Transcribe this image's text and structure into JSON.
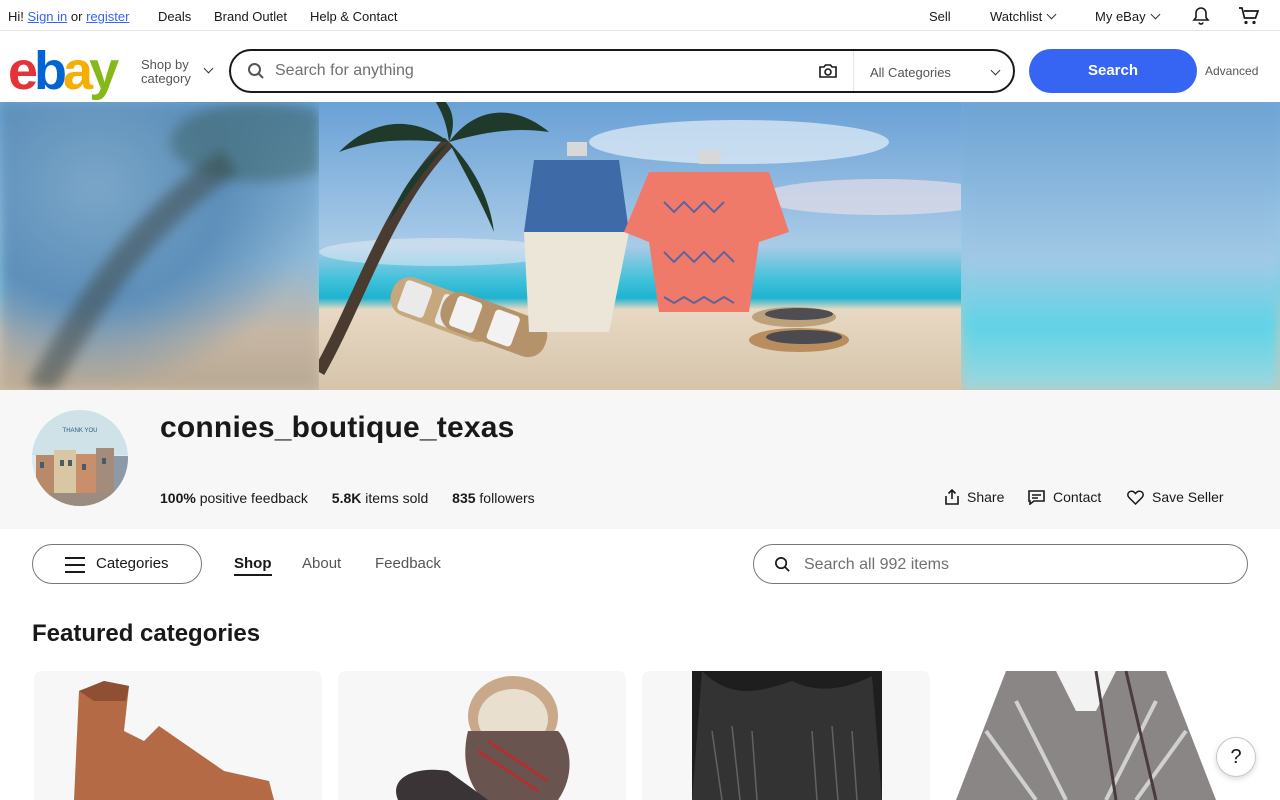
{
  "topnav": {
    "greeting": "Hi!",
    "signin": "Sign in",
    "or": "or",
    "register": "register",
    "deals": "Deals",
    "brand_outlet": "Brand Outlet",
    "help": "Help & Contact",
    "sell": "Sell",
    "watchlist": "Watchlist",
    "myebay": "My eBay"
  },
  "header": {
    "logo": {
      "e": "e",
      "b": "b",
      "a": "a",
      "y": "y"
    },
    "shop_by_line1": "Shop by",
    "shop_by_line2": "category",
    "search_placeholder": "Search for anything",
    "category_select": "All Categories",
    "search_button": "Search",
    "advanced": "Advanced"
  },
  "seller": {
    "name": "connies_boutique_texas",
    "avatar_caption": "THANK YOU",
    "feedback_value": "100%",
    "feedback_label": "positive feedback",
    "sold_value": "5.8K",
    "sold_label": "items sold",
    "followers_value": "835",
    "followers_label": "followers",
    "share": "Share",
    "contact": "Contact",
    "save": "Save Seller"
  },
  "store_nav": {
    "categories": "Categories",
    "tabs": [
      "Shop",
      "About",
      "Feedback"
    ],
    "active_tab": "Shop",
    "search_placeholder": "Search all 992 items"
  },
  "featured": {
    "title": "Featured categories"
  },
  "help_button": "?",
  "colors": {
    "accent": "#3665f3",
    "logo_e": "#e53238",
    "logo_b": "#0064d2",
    "logo_a": "#f5af02",
    "logo_y": "#86b817"
  }
}
